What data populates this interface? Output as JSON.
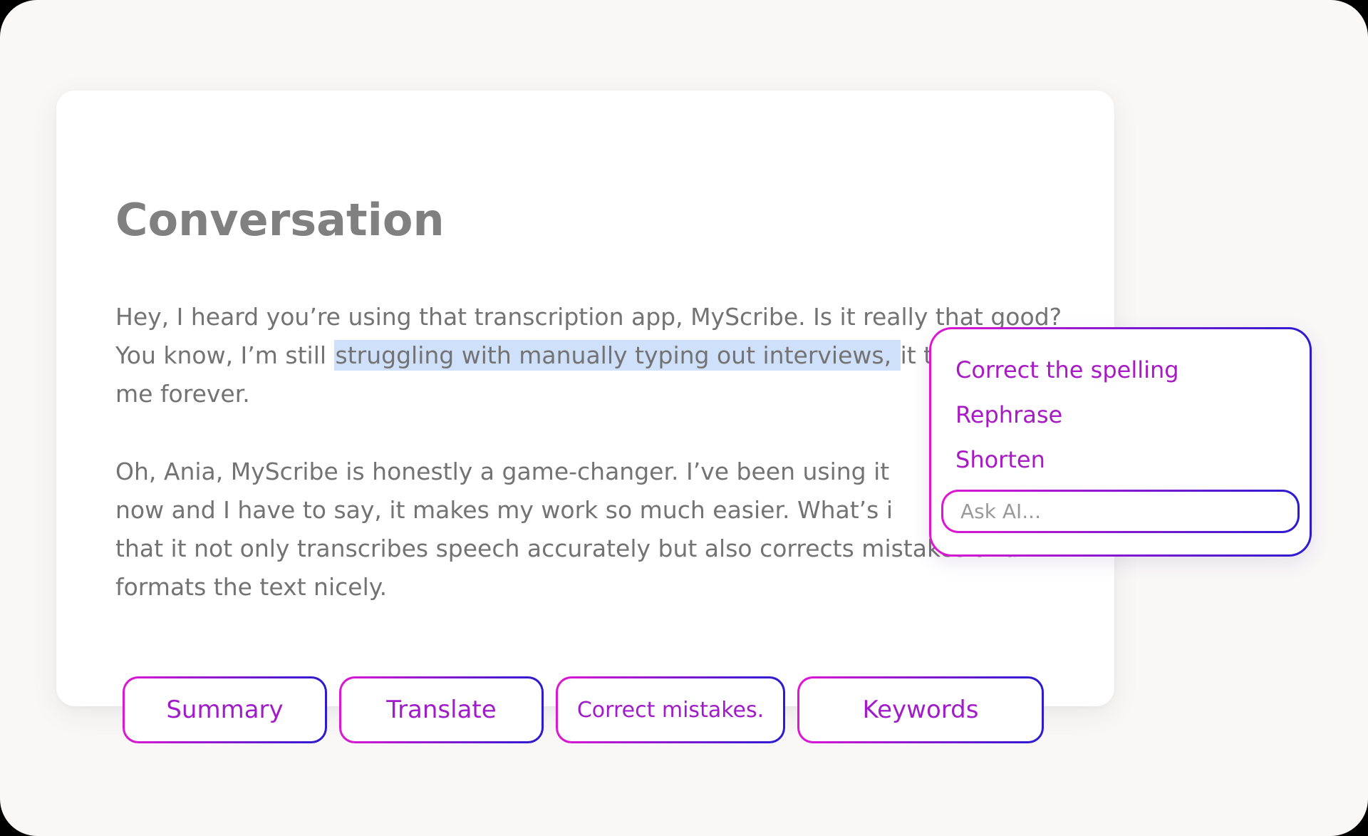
{
  "document": {
    "title": "Conversation",
    "paragraph1": {
      "line1": "Hey, I heard you’re using that transcription app, MyScribe. Is it really that good?",
      "line2_before": "You know, I’m still ",
      "line2_selected": "struggling with manually typing out interviews, ",
      "line2_hidden": "it takes",
      "line3": "me forever."
    },
    "paragraph2": {
      "line1": "Oh, Ania, MyScribe is honestly a game-changer. I’ve been using it",
      "line2": "now and I have to say, it makes my work so much easier. What’s i",
      "line3": "that it not only transcribes speech accurately but also corrects mistakes and",
      "line4": "formats the text nicely."
    }
  },
  "ai_menu": {
    "items": [
      "Correct the spelling",
      "Rephrase",
      "Shorten"
    ],
    "ask_placeholder": "Ask AI..."
  },
  "actions": [
    "Summary",
    "Translate",
    "Correct mistakes.",
    "Keywords"
  ],
  "colors": {
    "gradient_start": "#e017d2",
    "gradient_end": "#2b1bd0",
    "selection": "#cfe0fb",
    "title": "#808080",
    "body_text": "#737373"
  }
}
